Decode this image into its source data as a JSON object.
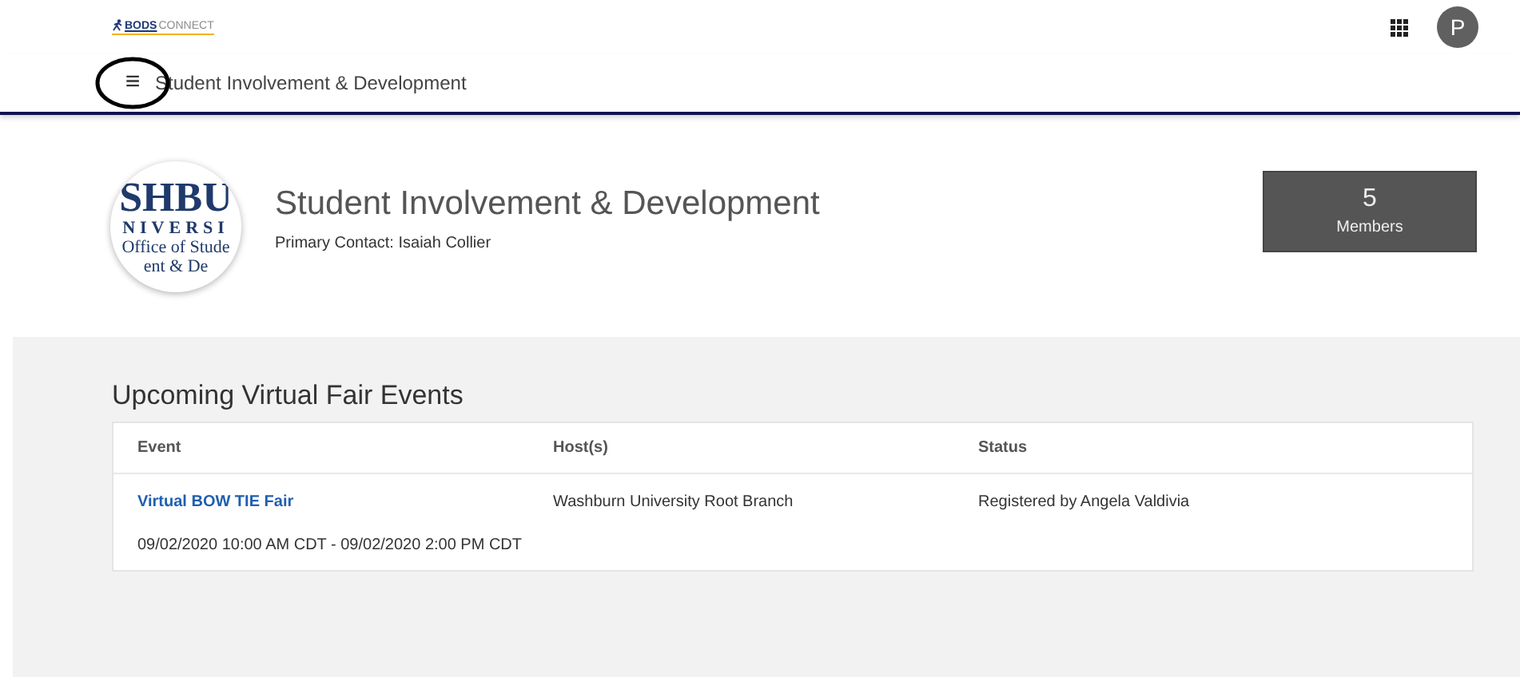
{
  "brand": {
    "logo_left": "BODS",
    "logo_right": "CONNECT"
  },
  "top_bar": {
    "avatar_letter": "P"
  },
  "nav": {
    "menu_icon": "≡",
    "title": "Student Involvement & Development"
  },
  "org": {
    "logo_lines": [
      "SHBU",
      "NIVERSI",
      "Office of Stude",
      "ent & De"
    ],
    "name": "Student Involvement & Development",
    "primary_contact": "Primary Contact: Isaiah Collier",
    "members_count": "5",
    "members_label": "Members"
  },
  "events": {
    "heading": "Upcoming Virtual Fair Events",
    "columns": [
      "Event",
      "Host(s)",
      "Status"
    ],
    "rows": [
      {
        "event": "Virtual BOW TIE Fair",
        "host": "Washburn University Root Branch",
        "status": "Registered by Angela Valdivia",
        "time": "09/02/2020 10:00 AM CDT - 09/02/2020 2:00 PM CDT"
      }
    ]
  }
}
